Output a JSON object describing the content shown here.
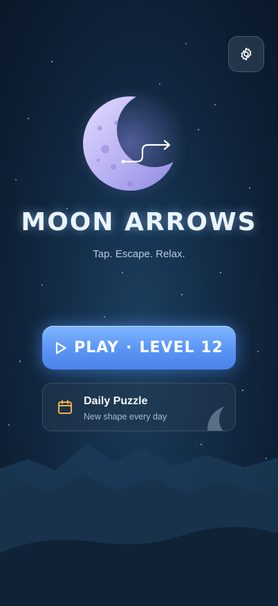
{
  "app": {
    "title": "MOON ARROWS",
    "tagline": "Tap. Escape. Relax."
  },
  "header": {
    "settings_icon": "gear-icon"
  },
  "hero": {
    "logo_icon": "moon-arrow-logo"
  },
  "play": {
    "icon": "play-icon",
    "label": "PLAY",
    "separator": "·",
    "level_label": "LEVEL 12"
  },
  "daily": {
    "icon": "calendar-icon",
    "title": "Daily Puzzle",
    "subtitle": "New shape every day",
    "decoration_icon": "crescent-moon-icon"
  },
  "colors": {
    "background": "#0f2238",
    "accent": "#5a94f5",
    "calendar_accent": "#f2b44a",
    "moon": "#b9b2f0"
  }
}
